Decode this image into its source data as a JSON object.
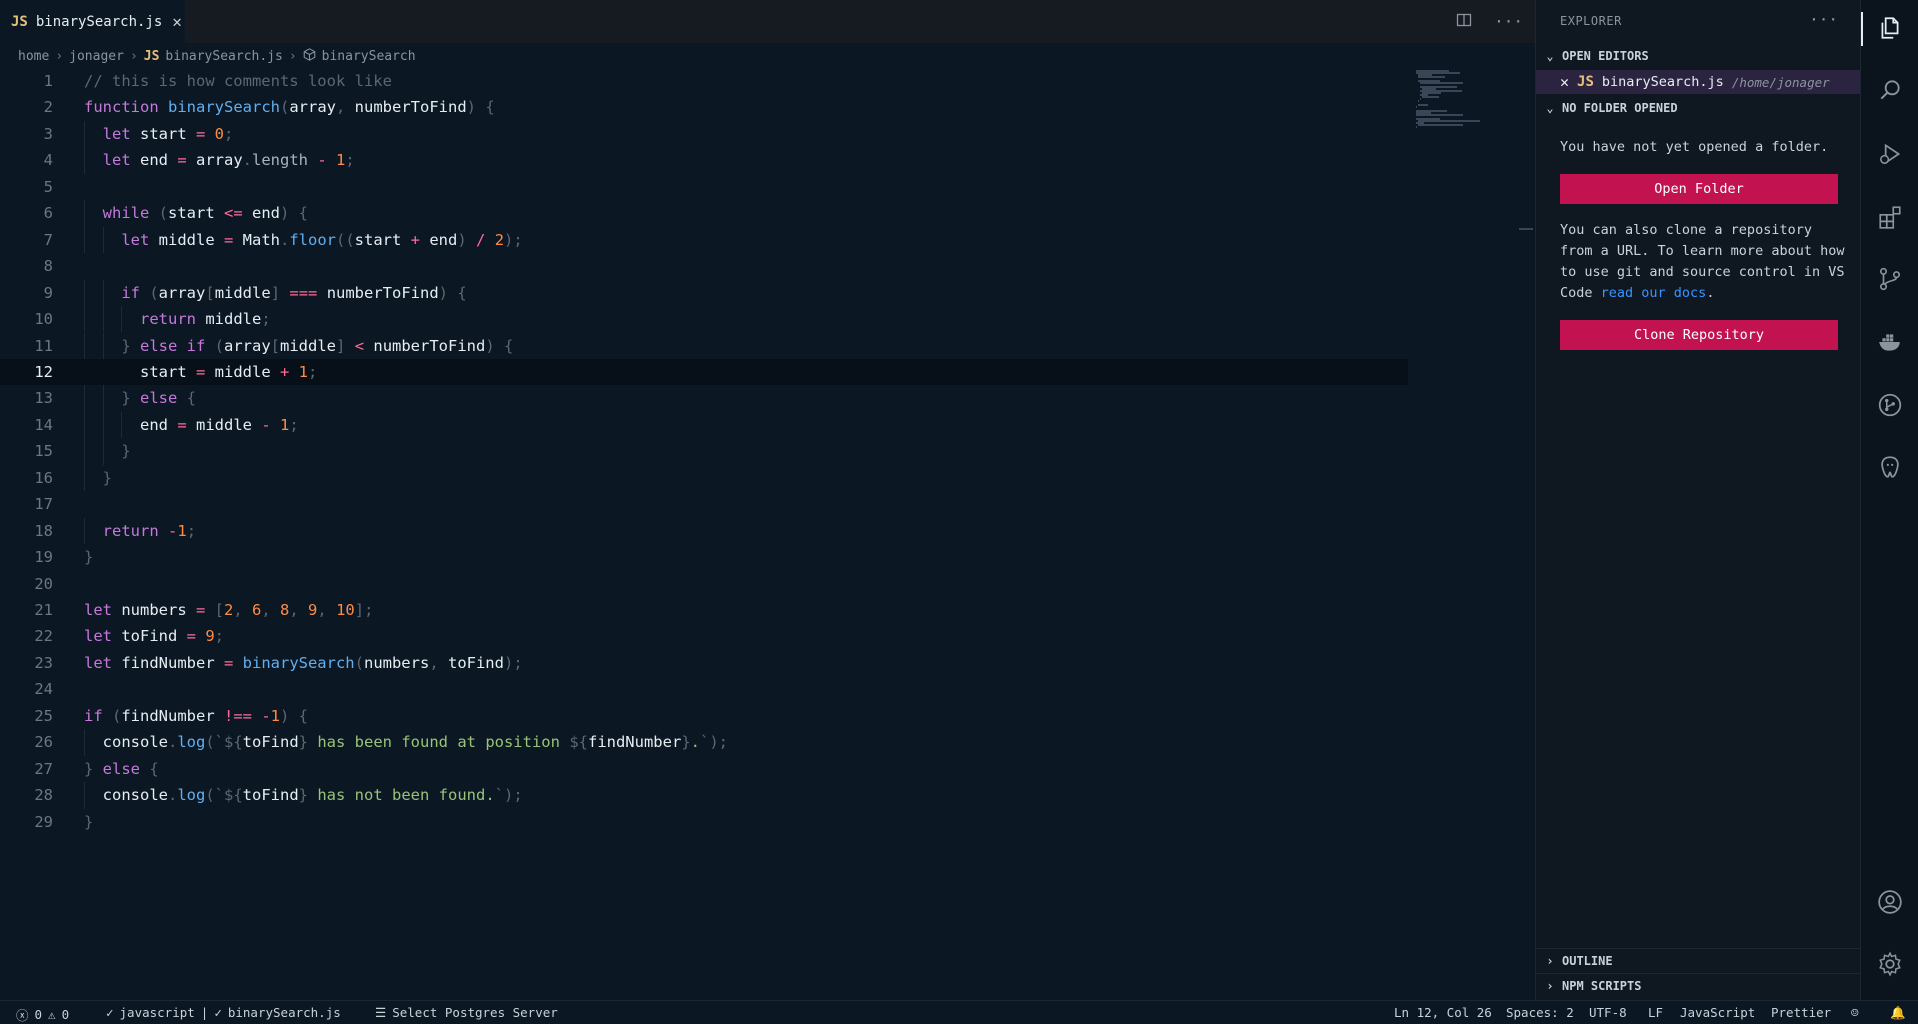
{
  "tab": {
    "badge": "JS",
    "title": "binarySearch.js"
  },
  "breadcrumb": {
    "home": "home",
    "user": "jonager",
    "file_badge": "JS",
    "file": "binarySearch.js",
    "symbol": "binarySearch"
  },
  "active_line": 12,
  "code_lines": [
    [
      [
        "c-com",
        "// this is how comments look like"
      ]
    ],
    [
      [
        "c-kw",
        "function "
      ],
      [
        "c-fn",
        "binarySearch"
      ],
      [
        "c-pun",
        "("
      ],
      [
        "c-txt",
        "array"
      ],
      [
        "c-pun",
        ", "
      ],
      [
        "c-txt",
        "numberToFind"
      ],
      [
        "c-pun",
        ") {"
      ]
    ],
    [
      [
        "c-txt",
        "  "
      ],
      [
        "c-kw",
        "let "
      ],
      [
        "c-txt",
        "start "
      ],
      [
        "c-op",
        "= "
      ],
      [
        "c-num",
        "0"
      ],
      [
        "c-pun",
        ";"
      ]
    ],
    [
      [
        "c-txt",
        "  "
      ],
      [
        "c-kw",
        "let "
      ],
      [
        "c-txt",
        "end "
      ],
      [
        "c-op",
        "= "
      ],
      [
        "c-txt",
        "array"
      ],
      [
        "c-pun",
        "."
      ],
      [
        "c-prop",
        "length "
      ],
      [
        "c-op",
        "- "
      ],
      [
        "c-num",
        "1"
      ],
      [
        "c-pun",
        ";"
      ]
    ],
    [],
    [
      [
        "c-txt",
        "  "
      ],
      [
        "c-kw",
        "while "
      ],
      [
        "c-pun",
        "("
      ],
      [
        "c-txt",
        "start "
      ],
      [
        "c-op",
        "<= "
      ],
      [
        "c-txt",
        "end"
      ],
      [
        "c-pun",
        ") {"
      ]
    ],
    [
      [
        "c-txt",
        "    "
      ],
      [
        "c-kw",
        "let "
      ],
      [
        "c-txt",
        "middle "
      ],
      [
        "c-op",
        "= "
      ],
      [
        "c-txt",
        "Math"
      ],
      [
        "c-pun",
        "."
      ],
      [
        "c-fn",
        "floor"
      ],
      [
        "c-pun",
        "(("
      ],
      [
        "c-txt",
        "start "
      ],
      [
        "c-op",
        "+ "
      ],
      [
        "c-txt",
        "end"
      ],
      [
        "c-pun",
        ") "
      ],
      [
        "c-op",
        "/ "
      ],
      [
        "c-num",
        "2"
      ],
      [
        "c-pun",
        ");"
      ]
    ],
    [],
    [
      [
        "c-txt",
        "    "
      ],
      [
        "c-kw",
        "if "
      ],
      [
        "c-pun",
        "("
      ],
      [
        "c-txt",
        "array"
      ],
      [
        "c-pun",
        "["
      ],
      [
        "c-txt",
        "middle"
      ],
      [
        "c-pun",
        "] "
      ],
      [
        "c-op",
        "=== "
      ],
      [
        "c-txt",
        "numberToFind"
      ],
      [
        "c-pun",
        ") {"
      ]
    ],
    [
      [
        "c-txt",
        "      "
      ],
      [
        "c-kw",
        "return "
      ],
      [
        "c-txt",
        "middle"
      ],
      [
        "c-pun",
        ";"
      ]
    ],
    [
      [
        "c-txt",
        "    "
      ],
      [
        "c-pun",
        "} "
      ],
      [
        "c-kw",
        "else if "
      ],
      [
        "c-pun",
        "("
      ],
      [
        "c-txt",
        "array"
      ],
      [
        "c-pun",
        "["
      ],
      [
        "c-txt",
        "middle"
      ],
      [
        "c-pun",
        "] "
      ],
      [
        "c-op",
        "< "
      ],
      [
        "c-txt",
        "numberToFind"
      ],
      [
        "c-pun",
        ") {"
      ]
    ],
    [
      [
        "c-txt",
        "      start "
      ],
      [
        "c-op",
        "= "
      ],
      [
        "c-txt",
        "middle "
      ],
      [
        "c-op",
        "+ "
      ],
      [
        "c-num",
        "1"
      ],
      [
        "c-pun",
        ";"
      ]
    ],
    [
      [
        "c-txt",
        "    "
      ],
      [
        "c-pun",
        "} "
      ],
      [
        "c-kw",
        "else "
      ],
      [
        "c-pun",
        "{"
      ]
    ],
    [
      [
        "c-txt",
        "      end "
      ],
      [
        "c-op",
        "= "
      ],
      [
        "c-txt",
        "middle "
      ],
      [
        "c-op",
        "- "
      ],
      [
        "c-num",
        "1"
      ],
      [
        "c-pun",
        ";"
      ]
    ],
    [
      [
        "c-txt",
        "    "
      ],
      [
        "c-pun",
        "}"
      ]
    ],
    [
      [
        "c-txt",
        "  "
      ],
      [
        "c-pun",
        "}"
      ]
    ],
    [],
    [
      [
        "c-txt",
        "  "
      ],
      [
        "c-kw",
        "return "
      ],
      [
        "c-op",
        "-"
      ],
      [
        "c-num",
        "1"
      ],
      [
        "c-pun",
        ";"
      ]
    ],
    [
      [
        "c-pun",
        "}"
      ]
    ],
    [],
    [
      [
        "c-kw",
        "let "
      ],
      [
        "c-txt",
        "numbers "
      ],
      [
        "c-op",
        "= "
      ],
      [
        "c-pun",
        "["
      ],
      [
        "c-num",
        "2"
      ],
      [
        "c-pun",
        ", "
      ],
      [
        "c-num",
        "6"
      ],
      [
        "c-pun",
        ", "
      ],
      [
        "c-num",
        "8"
      ],
      [
        "c-pun",
        ", "
      ],
      [
        "c-num",
        "9"
      ],
      [
        "c-pun",
        ", "
      ],
      [
        "c-num",
        "10"
      ],
      [
        "c-pun",
        "];"
      ]
    ],
    [
      [
        "c-kw",
        "let "
      ],
      [
        "c-txt",
        "toFind "
      ],
      [
        "c-op",
        "= "
      ],
      [
        "c-num",
        "9"
      ],
      [
        "c-pun",
        ";"
      ]
    ],
    [
      [
        "c-kw",
        "let "
      ],
      [
        "c-txt",
        "findNumber "
      ],
      [
        "c-op",
        "= "
      ],
      [
        "c-fn",
        "binarySearch"
      ],
      [
        "c-pun",
        "("
      ],
      [
        "c-txt",
        "numbers"
      ],
      [
        "c-pun",
        ", "
      ],
      [
        "c-txt",
        "toFind"
      ],
      [
        "c-pun",
        ");"
      ]
    ],
    [],
    [
      [
        "c-kw",
        "if "
      ],
      [
        "c-pun",
        "("
      ],
      [
        "c-txt",
        "findNumber "
      ],
      [
        "c-op",
        "!== -"
      ],
      [
        "c-num",
        "1"
      ],
      [
        "c-pun",
        ") {"
      ]
    ],
    [
      [
        "c-txt",
        "  console"
      ],
      [
        "c-pun",
        "."
      ],
      [
        "c-fn",
        "log"
      ],
      [
        "c-pun",
        "(`${"
      ],
      [
        "c-txt",
        "toFind"
      ],
      [
        "c-pun",
        "} "
      ],
      [
        "c-str",
        "has been found at position "
      ],
      [
        "c-pun",
        "${"
      ],
      [
        "c-txt",
        "findNumber"
      ],
      [
        "c-pun",
        "}"
      ],
      [
        "c-str",
        "."
      ],
      [
        "c-pun",
        "`);"
      ]
    ],
    [
      [
        "c-pun",
        "} "
      ],
      [
        "c-kw",
        "else "
      ],
      [
        "c-pun",
        "{"
      ]
    ],
    [
      [
        "c-txt",
        "  console"
      ],
      [
        "c-pun",
        "."
      ],
      [
        "c-fn",
        "log"
      ],
      [
        "c-pun",
        "(`${"
      ],
      [
        "c-txt",
        "toFind"
      ],
      [
        "c-pun",
        "} "
      ],
      [
        "c-str",
        "has not been found."
      ],
      [
        "c-pun",
        "`);"
      ]
    ],
    [
      [
        "c-pun",
        "}"
      ]
    ]
  ],
  "sidebar": {
    "title": "EXPLORER",
    "open_editors_label": "OPEN EDITORS",
    "open_editor": {
      "badge": "JS",
      "name": "binarySearch.js",
      "path": "/home/jonager"
    },
    "no_folder_label": "NO FOLDER OPENED",
    "no_folder_text": "You have not yet opened a folder.",
    "open_folder_button": "Open Folder",
    "clone_text": "You can also clone a repository from a URL. To learn more about how to use git and source control in VS Code ",
    "clone_link": "read our docs",
    "clone_text_end": ".",
    "clone_button": "Clone Repository",
    "outline_label": "OUTLINE",
    "npm_label": "NPM SCRIPTS"
  },
  "statusbar": {
    "errors": "0",
    "warnings": "0",
    "language_check": "javascript",
    "separator": "|",
    "file_check": "binarySearch.js",
    "postgres": "Select Postgres Server",
    "position": "Ln 12, Col 26",
    "spaces": "Spaces: 2",
    "encoding": "UTF-8",
    "eol": "LF",
    "language": "JavaScript",
    "formatter": "Prettier"
  },
  "activity_icons": [
    "explorer-icon",
    "search-icon",
    "run-debug-icon",
    "extensions-icon",
    "source-control-icon",
    "docker-icon",
    "git-graph-icon",
    "postgres-icon",
    "account-icon",
    "settings-gear-icon"
  ]
}
